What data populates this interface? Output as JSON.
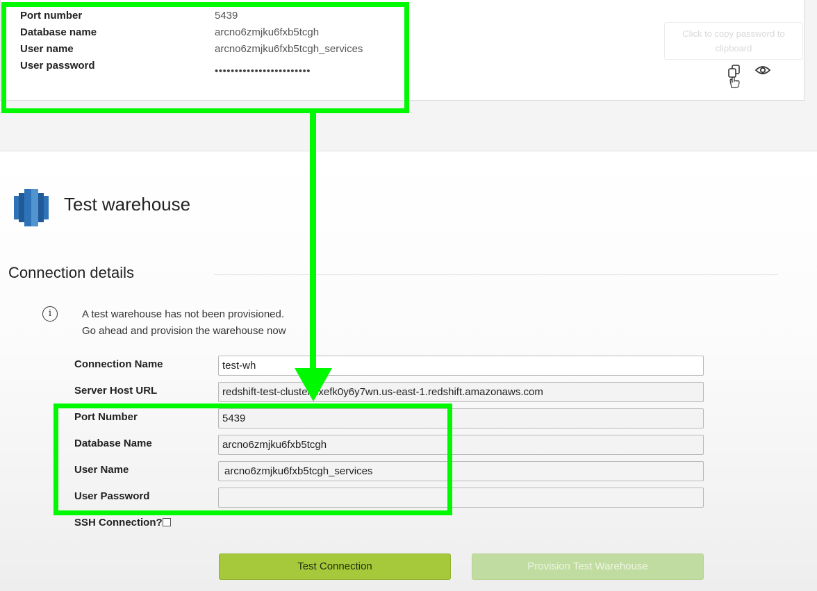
{
  "top_card": {
    "rows": [
      {
        "label": "Port number",
        "value": "5439"
      },
      {
        "label": "Database name",
        "value": "arcno6zmjku6fxb5tcgh"
      },
      {
        "label": "User name",
        "value": "arcno6zmjku6fxb5tcgh_services"
      },
      {
        "label": "User password",
        "value": "••••••••••••••••••••••••"
      }
    ],
    "copy_tooltip": "Click to copy password to clipboard",
    "copy_icon": "copy-icon",
    "show_icon": "eye-icon"
  },
  "warehouse": {
    "icon": "redshift-logo",
    "title": "Test warehouse"
  },
  "connection": {
    "section_title": "Connection details",
    "info_icon": "info-icon",
    "info_line1": "A test warehouse has not been provisioned.",
    "info_line2": "Go ahead and provision the warehouse now",
    "fields": [
      {
        "label": "Connection Name",
        "value": "test-wh"
      },
      {
        "label": "Server Host URL",
        "value": "redshift-test-cluster.cxefk0y6y7wn.us-east-1.redshift.amazonaws.com"
      },
      {
        "label": "Port Number",
        "value": "5439"
      },
      {
        "label": "Database Name",
        "value": "arcno6zmjku6fxb5tcgh"
      },
      {
        "label": "User Name",
        "value": "arcno6zmjku6fxb5tcgh_services"
      },
      {
        "label": "User Password",
        "value": ""
      }
    ],
    "ssh_label": "SSH Connection?",
    "ssh_checked": false
  },
  "buttons": {
    "test_label": "Test Connection",
    "provision_label": "Provision Test Warehouse"
  },
  "annotation_color": "#00f800"
}
